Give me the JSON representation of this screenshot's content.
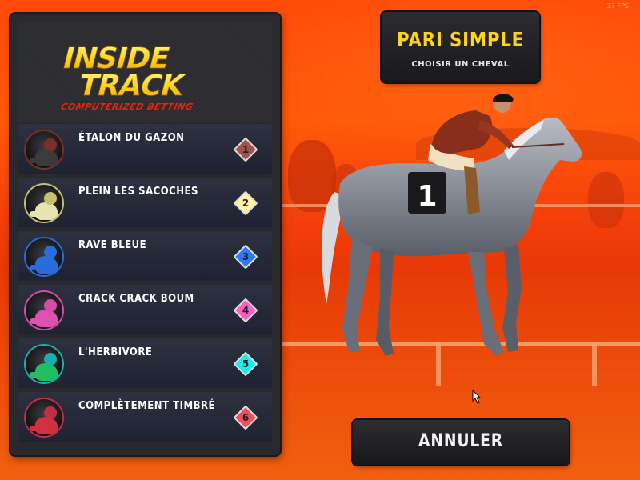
{
  "fps": "37 FPS",
  "logo": {
    "line1": "INSIDE",
    "line2": "TRACK",
    "subtitle": "COMPUTERIZED BETTING"
  },
  "bet": {
    "title": "PARI SIMPLE",
    "subtitle": "CHOISIR UN CHEVAL"
  },
  "horses": [
    {
      "name": "ÉTALON DU GAZON",
      "number": "1",
      "color": "#a0554a",
      "silk": "#3b3b3b",
      "ring": "#7a3028"
    },
    {
      "name": "PLEIN LES SACOCHES",
      "number": "2",
      "color": "#fff4a8",
      "silk": "#e8e4b0",
      "ring": "#c8c070"
    },
    {
      "name": "RAVE BLEUE",
      "number": "3",
      "color": "#2a7bff",
      "silk": "#2a6cd8",
      "ring": "#2a6cd8"
    },
    {
      "name": "CRACK CRACK BOUM",
      "number": "4",
      "color": "#ff5ec4",
      "silk": "#e050b0",
      "ring": "#d84aa8"
    },
    {
      "name": "L'HERBIVORE",
      "number": "5",
      "color": "#12f0f0",
      "silk": "#20c060",
      "ring": "#18b0b0"
    },
    {
      "name": "COMPLÈTEMENT TIMBRÉ",
      "number": "6",
      "color": "#f0505e",
      "silk": "#d03040",
      "ring": "#c03040"
    }
  ],
  "saddle_number": "1",
  "cancel_label": "ANNULER"
}
